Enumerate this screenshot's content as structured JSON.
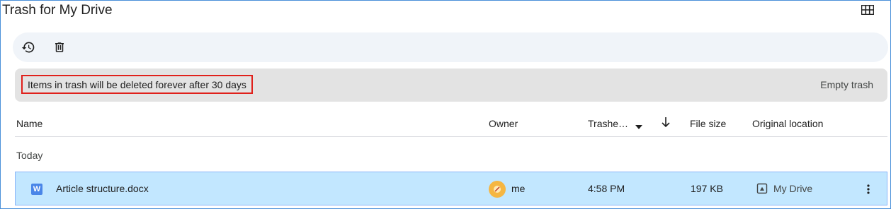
{
  "page": {
    "title": "Trash for My Drive"
  },
  "toolbar": {
    "restore_icon": "restore-icon",
    "delete_icon": "trash-icon",
    "view_icon": "grid-view-icon"
  },
  "banner": {
    "message": "Items in trash will be deleted forever after 30 days",
    "action": "Empty trash",
    "highlight_color": "#e0201b"
  },
  "columns": {
    "name": "Name",
    "owner": "Owner",
    "trashed": "Trashe…",
    "file_size": "File size",
    "location": "Original location"
  },
  "group": {
    "label": "Today"
  },
  "rows": [
    {
      "file_type_badge": "W",
      "name": "Article structure.docx",
      "owner": "me",
      "trashed": "4:58 PM",
      "size": "197 KB",
      "location": "My Drive"
    }
  ],
  "colors": {
    "selected_row": "#c2e7ff",
    "toolbar_bg": "#f0f4f9",
    "banner_bg": "#e3e3e3",
    "word_icon": "#4a86e8"
  }
}
